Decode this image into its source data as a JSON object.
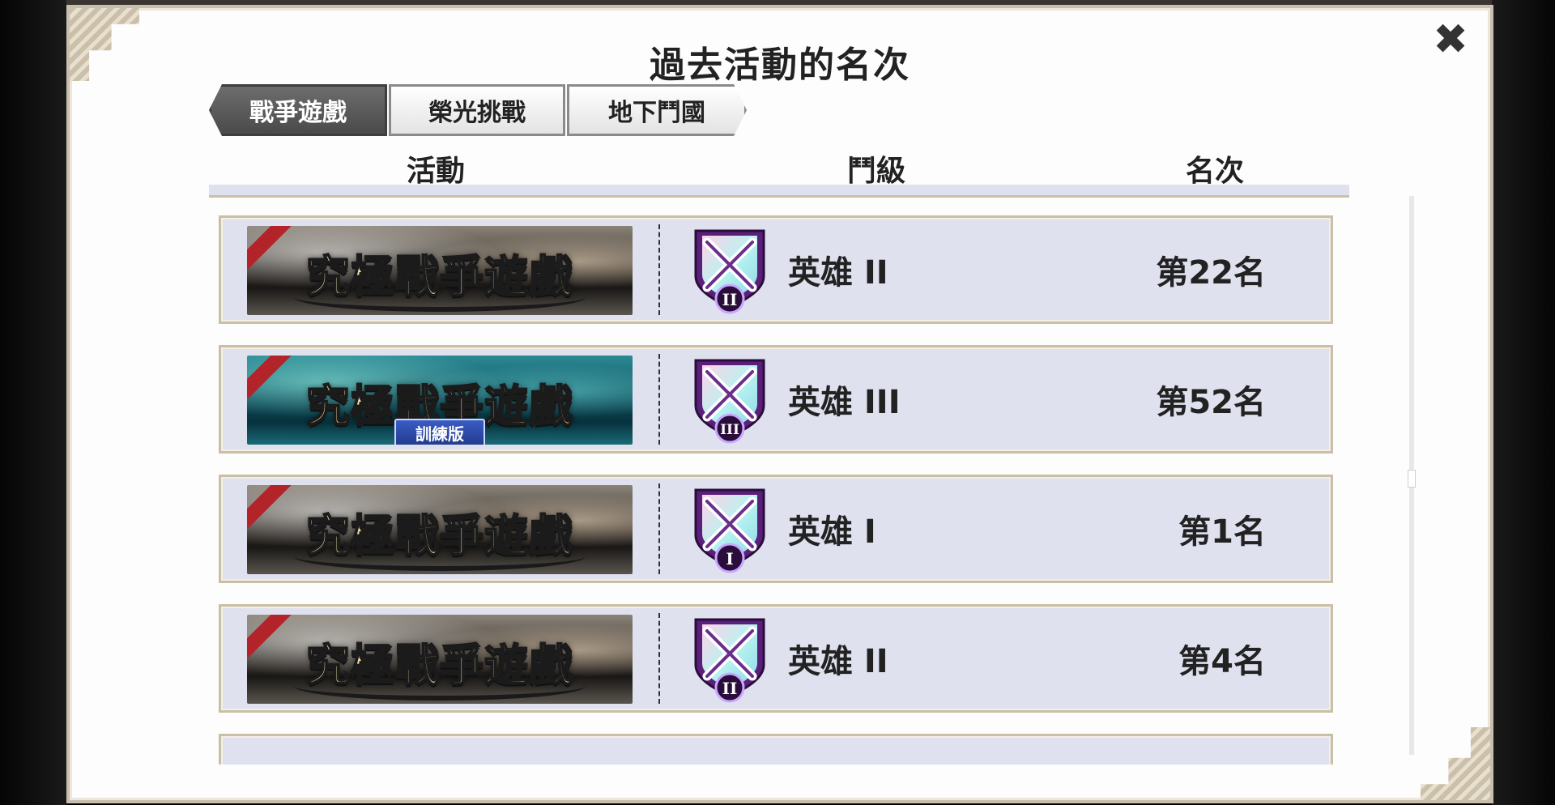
{
  "dialog": {
    "title": "過去活動的名次",
    "close_icon": "close-icon"
  },
  "tabs": [
    {
      "label": "戰爭遊戲",
      "active": true
    },
    {
      "label": "榮光挑戰",
      "active": false
    },
    {
      "label": "地下鬥國",
      "active": false
    }
  ],
  "columns": {
    "event": "活動",
    "tier": "鬥級",
    "rank": "名次"
  },
  "rows": [
    {
      "banner_title": "究極戰爭遊戲",
      "banner_subtitle": "",
      "variant": "normal",
      "badge_numeral": "II",
      "tier": "英雄 II",
      "rank": "第22名"
    },
    {
      "banner_title": "究極戰爭遊戲",
      "banner_subtitle": "訓練版",
      "variant": "training",
      "badge_numeral": "III",
      "tier": "英雄 III",
      "rank": "第52名"
    },
    {
      "banner_title": "究極戰爭遊戲",
      "banner_subtitle": "",
      "variant": "normal",
      "badge_numeral": "I",
      "tier": "英雄 I",
      "rank": "第1名"
    },
    {
      "banner_title": "究極戰爭遊戲",
      "banner_subtitle": "",
      "variant": "normal",
      "badge_numeral": "II",
      "tier": "英雄 II",
      "rank": "第4名"
    }
  ],
  "colors": {
    "row_bg": "#dfe1ef",
    "row_border": "#c8bfa4",
    "active_tab": "#4a4a4a",
    "badge_purple": "#5a1f7a"
  }
}
